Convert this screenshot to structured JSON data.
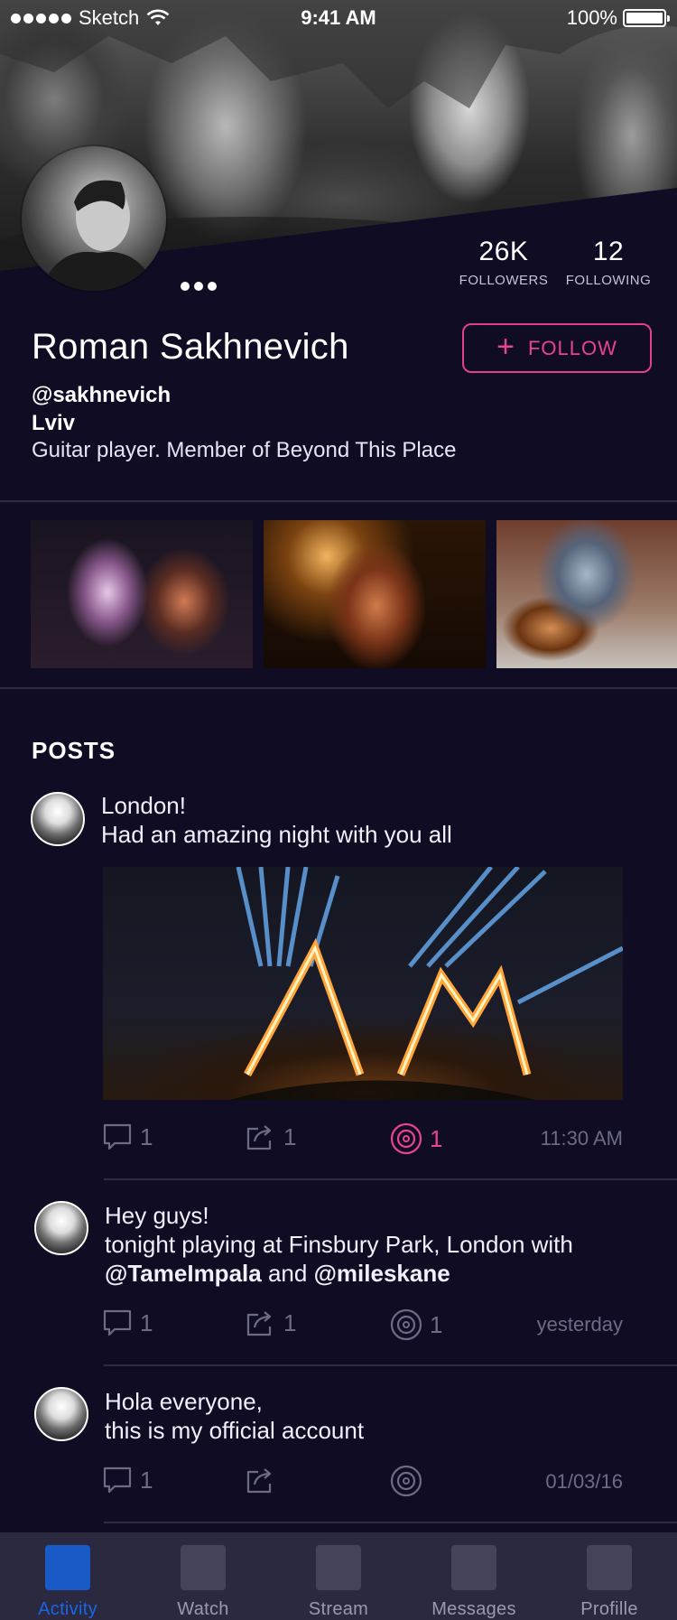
{
  "status_bar": {
    "carrier": "Sketch",
    "time": "9:41 AM",
    "battery": "100%"
  },
  "profile": {
    "name": "Roman Sakhnevich",
    "handle": "@sakhnevich",
    "location": "Lviv",
    "bio": "Guitar player. Member of Beyond This Place",
    "follow_label": "FOLLOW",
    "followers": {
      "value": "26K",
      "label": "FOLLOWERS"
    },
    "following": {
      "value": "12",
      "label": "FOLLOWING"
    }
  },
  "posts_heading": "POSTS",
  "posts": [
    {
      "line1": "London!",
      "line2": "Had an amazing night with you all",
      "comments": "1",
      "shares": "1",
      "likes": "1",
      "time": "11:30 AM"
    },
    {
      "line1": "Hey guys!",
      "line2": "tonight playing at Finsbury Park, London with",
      "mention1": "@TameImpala",
      "and_word": "and",
      "mention2": "@mileskane",
      "comments": "1",
      "shares": "1",
      "likes": "1",
      "time": "yesterday"
    },
    {
      "line1": "Hola everyone,",
      "line2": "this is my official account",
      "comments": "1",
      "time": "01/03/16"
    }
  ],
  "tabs": [
    {
      "label": "Activity",
      "active": true
    },
    {
      "label": "Watch"
    },
    {
      "label": "Stream"
    },
    {
      "label": "Messages"
    },
    {
      "label": "Profille"
    }
  ],
  "colors": {
    "background": "#0f0c24",
    "accent_pink": "#e94394",
    "tab_active": "#1a65e6",
    "muted": "#6e6b86"
  },
  "icons": {
    "comment": "comment-icon",
    "share": "share-icon",
    "like": "vinyl-record-icon"
  }
}
